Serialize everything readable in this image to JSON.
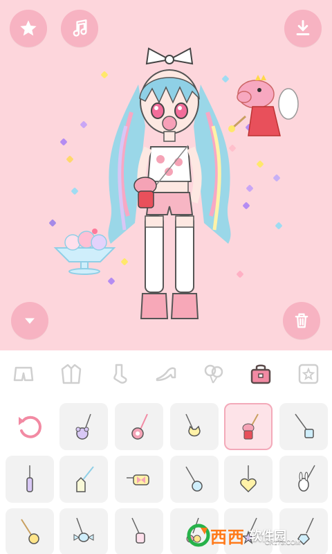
{
  "colors": {
    "stage_bg": "#fdd6dc",
    "button_bg": "#f7b3c2",
    "panel_bg": "#ffffff",
    "cell_bg": "#f2f2f2",
    "selected_outline": "#f3a9b9",
    "accent_pink": "#f28aa3"
  },
  "toolbar": {
    "favorite_icon": "star-icon",
    "music_icon": "music-note-icon",
    "download_icon": "download-icon",
    "collapse_icon": "chevron-down-icon",
    "delete_icon": "trash-icon"
  },
  "tabs": [
    {
      "icon": "shorts-icon",
      "active": false
    },
    {
      "icon": "jacket-icon",
      "active": false
    },
    {
      "icon": "sock-icon",
      "active": false
    },
    {
      "icon": "high-heel-icon",
      "active": false
    },
    {
      "icon": "balloons-icon",
      "active": false
    },
    {
      "icon": "bag-icon",
      "active": true
    },
    {
      "icon": "star-frame-icon",
      "active": false
    }
  ],
  "items": {
    "reset_icon": "reset-icon",
    "selected_index": 4,
    "list": [
      "bear-bag",
      "flower-bag",
      "cat-bag",
      "peppa-bag",
      "crossbody-bag",
      "bottle-charm",
      "milk-carton-bag",
      "bow-pouch",
      "candy-bag",
      "heart-bag",
      "bunny-charm",
      "heart-charm",
      "wrapped-candy-charm",
      "ice-pop-charm",
      "cherry-charm",
      "star-bag",
      "gem-charm"
    ]
  },
  "watermark": {
    "title": "西西",
    "subtitle": "软件园",
    "url": "CR173.COM"
  }
}
